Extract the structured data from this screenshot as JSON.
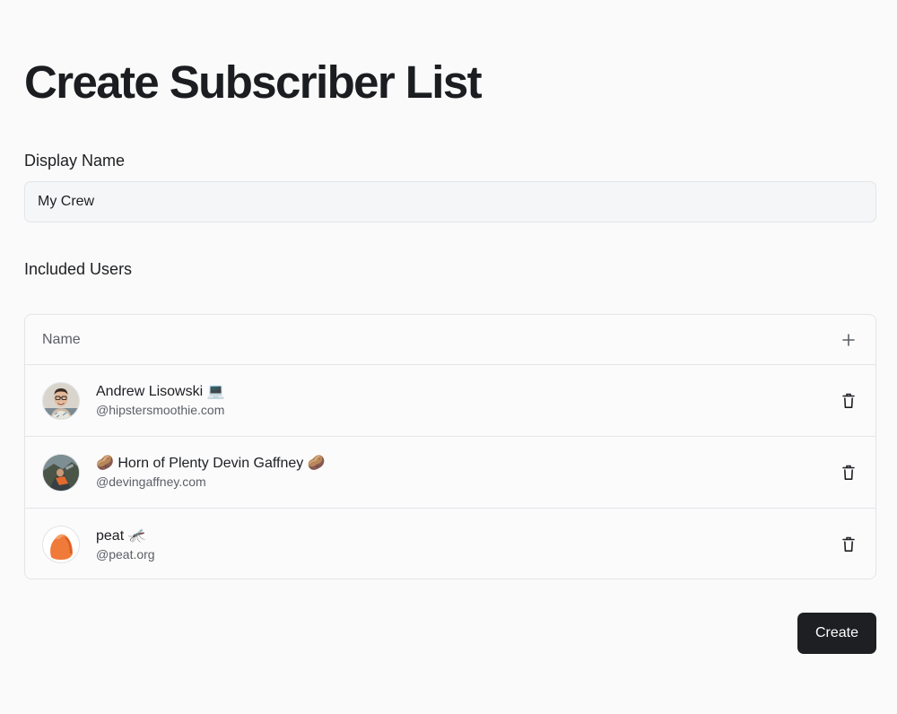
{
  "page": {
    "title": "Create Subscriber List"
  },
  "form": {
    "display_name_label": "Display Name",
    "display_name_value": "My Crew",
    "included_users_label": "Included Users"
  },
  "table": {
    "column_name": "Name",
    "add_icon": "plus-icon",
    "delete_icon": "trash-icon",
    "users": [
      {
        "name": "Andrew Lisowski 💻",
        "handle": "@hipstersmoothie.com",
        "avatar": "avatar-photo-andrew"
      },
      {
        "name": "🥔 Horn of Plenty Devin Gaffney 🥔",
        "handle": "@devingaffney.com",
        "avatar": "avatar-photo-devin"
      },
      {
        "name": "peat 🦟",
        "handle": "@peat.org",
        "avatar": "avatar-photo-peat"
      }
    ]
  },
  "actions": {
    "create_label": "Create"
  },
  "colors": {
    "background": "#fafafa",
    "primary_button": "#1d1f22",
    "border": "#e3e5e8",
    "muted_text": "#5c6066"
  }
}
